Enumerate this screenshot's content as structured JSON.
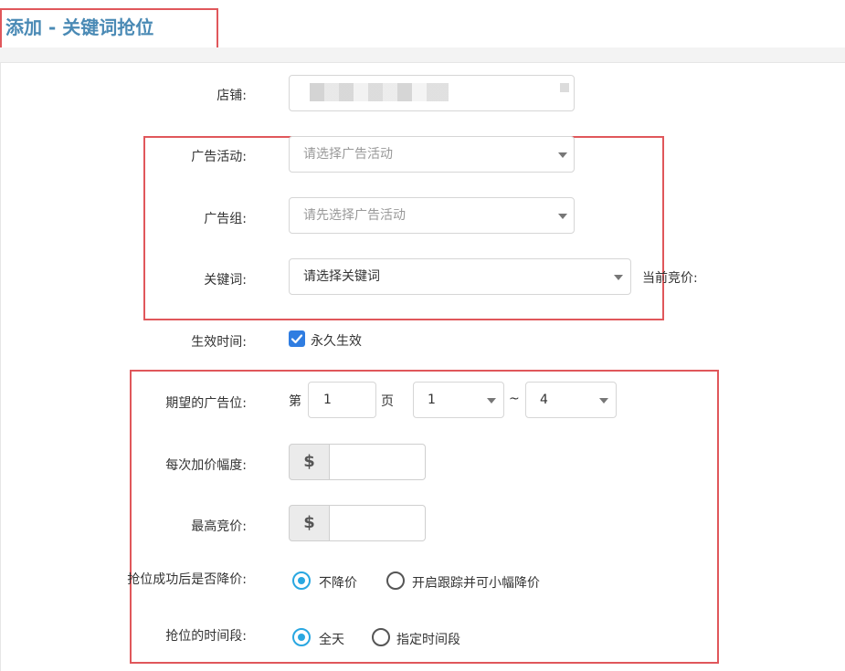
{
  "page": {
    "title": "添加 - 关键词抢位"
  },
  "form": {
    "store": {
      "label": "店铺:"
    },
    "campaign": {
      "label": "广告活动:",
      "placeholder": "请选择广告活动"
    },
    "ad_group": {
      "label": "广告组:",
      "placeholder": "请先选择广告活动"
    },
    "keyword": {
      "label": "关键词:",
      "placeholder": "请选择关键词",
      "current_bid_label": "当前竞价:"
    },
    "effective_time": {
      "label": "生效时间:",
      "checkbox_label": "永久生效",
      "checked": true
    },
    "desired_position": {
      "label": "期望的广告位:",
      "page_prefix": "第",
      "page_value": "1",
      "page_suffix": "页",
      "from_value": "1",
      "range_sep": "~",
      "to_value": "4"
    },
    "increment": {
      "label": "每次加价幅度:",
      "currency": "$",
      "value": ""
    },
    "max_bid": {
      "label": "最高竞价:",
      "currency": "$",
      "value": ""
    },
    "lower_after_win": {
      "label": "抢位成功后是否降价:",
      "options": [
        "不降价",
        "开启跟踪并可小幅降价"
      ],
      "selected": 0
    },
    "time_period": {
      "label": "抢位的时间段:",
      "options": [
        "全天",
        "指定时间段"
      ],
      "selected": 0
    }
  },
  "colors": {
    "accent": "#29a7e1",
    "title": "#4a8ab5",
    "highlight_box": "#e0575b",
    "checkbox": "#2f7de1"
  }
}
